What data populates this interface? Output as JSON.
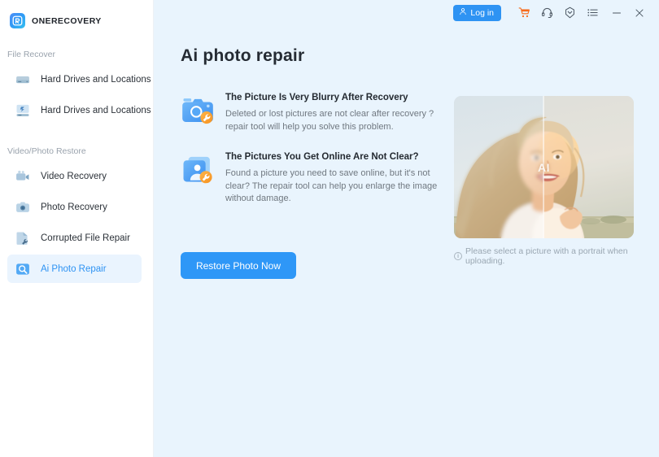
{
  "brand": {
    "name": "ONERECOVERY",
    "logo_icon": "onerecovery-logo-icon"
  },
  "titlebar": {
    "login_label": "Log in",
    "login_icon": "user-icon",
    "icons": [
      {
        "name": "cart-icon",
        "color": "#f76b1c"
      },
      {
        "name": "headset-icon",
        "color": "#4a5560"
      },
      {
        "name": "update-shield-icon",
        "color": "#4a5560"
      },
      {
        "name": "menu-list-icon",
        "color": "#4a5560"
      },
      {
        "name": "minimize-icon",
        "color": "#4a5560"
      },
      {
        "name": "close-icon",
        "color": "#4a5560"
      }
    ]
  },
  "sidebar": {
    "groups": [
      {
        "title": "File Recover",
        "items": [
          {
            "label": "Hard Drives and Locations",
            "icon": "hard-drive-icon",
            "active": false
          },
          {
            "label": "Hard Drives and Locations",
            "icon": "nas-drive-icon",
            "active": false
          }
        ]
      },
      {
        "title": "Video/Photo Restore",
        "items": [
          {
            "label": "Video Recovery",
            "icon": "video-camera-icon",
            "active": false
          },
          {
            "label": "Photo Recovery",
            "icon": "photo-camera-icon",
            "active": false
          },
          {
            "label": "Corrupted File Repair",
            "icon": "file-repair-icon",
            "active": false
          },
          {
            "label": "Ai Photo Repair",
            "icon": "ai-photo-repair-icon",
            "active": true
          }
        ]
      }
    ]
  },
  "main": {
    "page_title": "Ai photo repair",
    "features": [
      {
        "icon": "camera-repair-icon",
        "title": "The Picture Is Very Blurry After Recovery",
        "desc": "Deleted or lost pictures are not clear after recovery ?repair tool will help you solve this problem."
      },
      {
        "icon": "photo-card-repair-icon",
        "title": "The Pictures You Get Online Are Not Clear?",
        "desc": "Found a picture you need to save online, but it's not clear? The repair tool can help you enlarge the image without damage."
      }
    ],
    "cta_label": "Restore Photo Now",
    "preview": {
      "ai_badge": "AI",
      "hint": "Please select a picture with a portrait when uploading."
    }
  },
  "colors": {
    "accent": "#2e93f3",
    "cta": "#2e97f7",
    "cart": "#f76b1c",
    "main_bg": "#e9f4fd",
    "active_item_bg": "#eaf4fe"
  }
}
